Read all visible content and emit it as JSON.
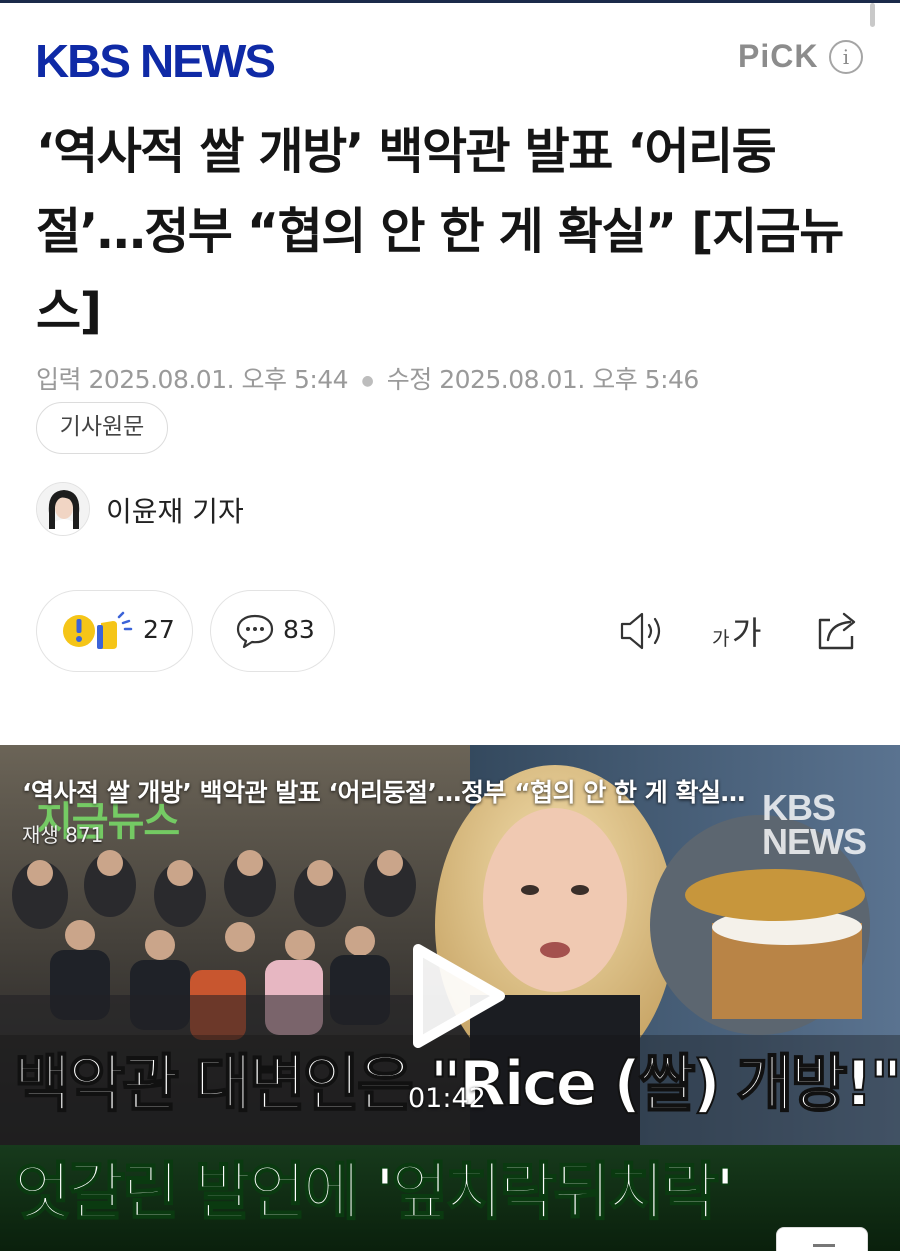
{
  "header": {
    "logo": "KBS NEWS",
    "pick_label": "PiCK",
    "info_icon": "i"
  },
  "article": {
    "title": "‘역사적 쌀 개방’ 백악관 발표 ‘어리둥절’…정부 “협의 안 한 게 확실” [지금뉴스]",
    "input_label": "입력",
    "input_time": "2025.08.01. 오후 5:44",
    "edit_label": "수정",
    "edit_time": "2025.08.01. 오후 5:46",
    "original_button": "기사원문",
    "reporter": "이윤재 기자"
  },
  "actions": {
    "reaction_count": "27",
    "comment_count": "83",
    "font_small": "가",
    "font_big": "가",
    "icons": [
      "reaction-emoji-icon",
      "comment-bubble-icon",
      "speaker-icon",
      "font-size-icon",
      "share-icon"
    ]
  },
  "video": {
    "title": "‘역사적 쌀 개방’ 백악관 발표 ‘어리둥절’…정부 “협의 안 한 게 확실…",
    "views": "재생 871",
    "tag": "지금뉴스",
    "watermark_line1": "KBS",
    "watermark_line2": "NEWS",
    "caption_line1": "백악관 대변인은 \"Rice (쌀) 개방!\"",
    "caption_line2": "엇갈린 발언에 '엎치락뒤치락'",
    "duration": "01:42"
  },
  "colors": {
    "brand_blue": "#0f2aa6",
    "meta_gray": "#9a9a9a",
    "caption_green": "#7be86a"
  }
}
